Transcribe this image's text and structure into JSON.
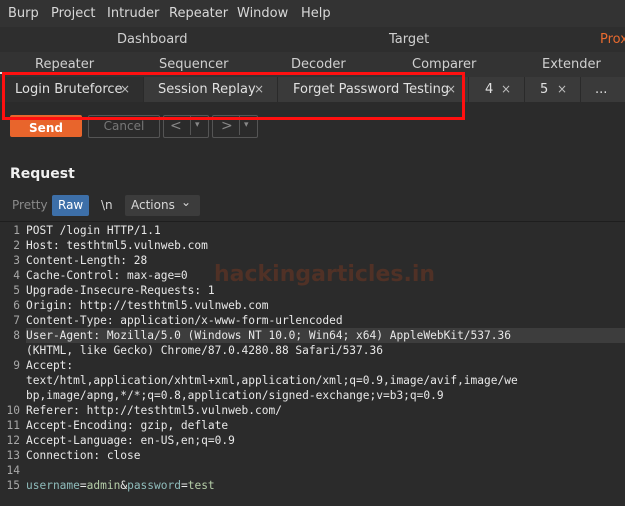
{
  "menu": [
    "Burp",
    "Project",
    "Intruder",
    "Repeater",
    "Window",
    "Help"
  ],
  "tools_row1": [
    "Dashboard",
    "Target",
    "Prox"
  ],
  "tools_row2": [
    "Repeater",
    "Sequencer",
    "Decoder",
    "Comparer",
    "Extender"
  ],
  "repeater_tabs": [
    {
      "label": "Login Bruteforce",
      "close": "×"
    },
    {
      "label": "Session Replay",
      "close": "×"
    },
    {
      "label": "Forget Password Testing",
      "close": "×"
    },
    {
      "label": "4",
      "close": "×"
    },
    {
      "label": "5",
      "close": "×"
    },
    {
      "label": "...",
      "close": ""
    }
  ],
  "toolbar": {
    "send": "Send",
    "cancel": "Cancel",
    "back": "<",
    "back_menu": "▾",
    "fwd": ">",
    "fwd_menu": "▾"
  },
  "request": {
    "title": "Request",
    "view_buttons": {
      "pretty": "Pretty",
      "raw": "Raw",
      "newline": "\\n",
      "actions": "Actions",
      "actions_caret": "⌄"
    }
  },
  "editor": {
    "line_numbers": [
      "1",
      "2",
      "3",
      "4",
      "5",
      "6",
      "7",
      "8",
      "9",
      "10",
      "11",
      "12",
      "13",
      "14",
      "15"
    ],
    "lines": [
      "POST /login HTTP/1.1",
      "Host: testhtml5.vulnweb.com",
      "Content-Length: 28",
      "Cache-Control: max-age=0",
      "Upgrade-Insecure-Requests: 1",
      "Origin: http://testhtml5.vulnweb.com",
      "Content-Type: application/x-www-form-urlencoded",
      "User-Agent: Mozilla/5.0 (Windows NT 10.0; Win64; x64) AppleWebKit/537.36",
      "(KHTML, like Gecko) Chrome/87.0.4280.88 Safari/537.36",
      "Accept:",
      "text/html,application/xhtml+xml,application/xml;q=0.9,image/avif,image/we",
      "bp,image/apng,*/*;q=0.8,application/signed-exchange;v=b3;q=0.9",
      "Referer: http://testhtml5.vulnweb.com/",
      "Accept-Encoding: gzip, deflate",
      "Accept-Language: en-US,en;q=0.9",
      "Connection: close",
      ""
    ],
    "body_param1_name": "username",
    "body_eq": "=",
    "body_param1_val": "admin",
    "body_amp": "&",
    "body_param2_name": "password",
    "body_param2_val": "test"
  },
  "watermark": "hackingarticles.in",
  "colors": {
    "accent": "#e8652c",
    "highlight": "#ff1010",
    "raw_active": "#3d6fa8"
  }
}
